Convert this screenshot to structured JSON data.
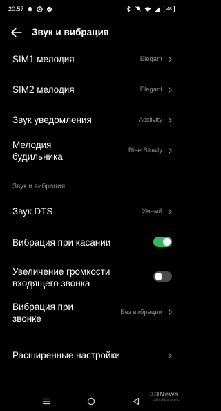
{
  "status_bar": {
    "time": "20:57",
    "battery": "48",
    "icons": [
      "bell-icon",
      "chat-icon",
      "dot-icon",
      "bluetooth-icon",
      "mute-icon",
      "wifi-icon",
      "signal-icon"
    ]
  },
  "header": {
    "title": "Звук и вибрация",
    "back_icon": "arrow-left-icon"
  },
  "rows": [
    {
      "label": "SIM1 мелодия",
      "value": "Elegant"
    },
    {
      "label": "SIM2 мелодия",
      "value": "Elegant"
    },
    {
      "label": "Звук уведомления",
      "value": "Acclivity"
    },
    {
      "label_line1": "Мелодия",
      "label_line2": "будильника",
      "value": "Rise Slowly"
    }
  ],
  "section": {
    "title": "Звук и вибрация",
    "items": [
      {
        "label": "Звук DTS",
        "value": "Умный"
      },
      {
        "label": "Вибрация при касании",
        "toggle": true
      },
      {
        "label_line1": "Увеличение громкости",
        "label_line2": "входящего звонка",
        "toggle": false
      },
      {
        "label_line1": "Вибрация при",
        "label_line2": "звонке",
        "value": "Без вибрации"
      }
    ]
  },
  "advanced": {
    "label": "Расширенные настройки"
  },
  "nav_bar": {
    "icons": [
      "menu-icon",
      "home-icon",
      "back-triangle-icon"
    ]
  },
  "watermark": {
    "line1": "3DNews",
    "line2": "Daily Digital Digest"
  },
  "colors": {
    "background": "#000000",
    "text": "#ffffff",
    "secondary_text": "#8a8a8a",
    "toggle_on": "#31b95f",
    "toggle_off": "#4a4a4a"
  }
}
